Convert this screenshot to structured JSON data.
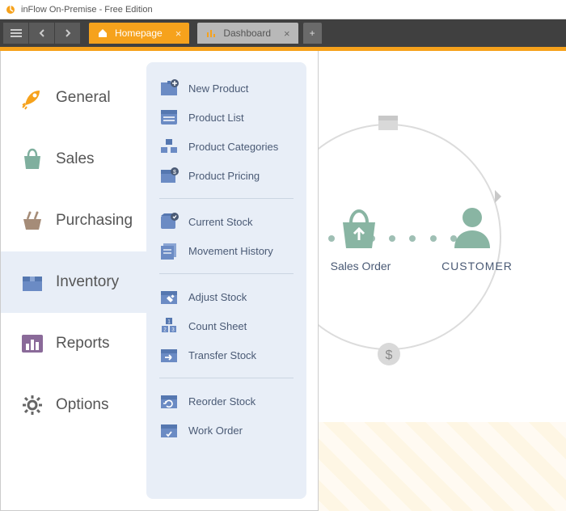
{
  "window": {
    "title": "inFlow On-Premise - Free Edition"
  },
  "tabs": {
    "home": "Homepage",
    "dashboard": "Dashboard"
  },
  "sidebar": {
    "general": "General",
    "sales": "Sales",
    "purchasing": "Purchasing",
    "inventory": "Inventory",
    "reports": "Reports",
    "options": "Options"
  },
  "submenu": {
    "new_product": "New Product",
    "product_list": "Product List",
    "product_categories": "Product Categories",
    "product_pricing": "Product Pricing",
    "current_stock": "Current Stock",
    "movement_history": "Movement History",
    "adjust_stock": "Adjust Stock",
    "count_sheet": "Count Sheet",
    "transfer_stock": "Transfer Stock",
    "reorder_stock": "Reorder Stock",
    "work_order": "Work Order"
  },
  "diagram": {
    "sales_order": "Sales Order",
    "customer": "CUSTOMER"
  },
  "colors": {
    "accent": "#f6a21c",
    "panel": "#e8eef7",
    "icon_blue": "#6b8bc4",
    "icon_green": "#7faf9e",
    "icon_brown": "#a58c78",
    "icon_purple": "#8a6a99",
    "icon_gray": "#888"
  }
}
